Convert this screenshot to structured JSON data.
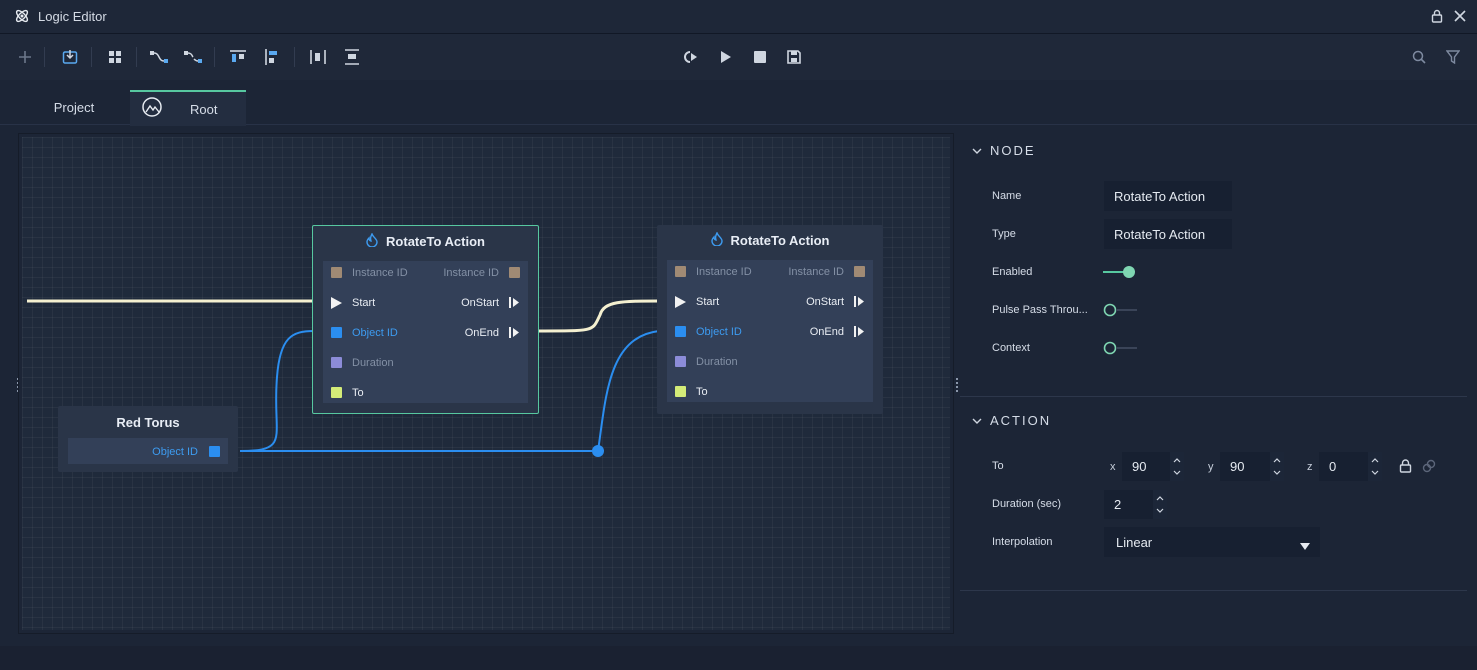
{
  "window": {
    "title": "Logic Editor"
  },
  "toolbar": {
    "left_buttons": [
      "add-icon",
      "import-icon",
      "grid-icon",
      "connect-icon",
      "disconnect-icon",
      "align-top-icon",
      "align-left-icon",
      "distribute-h-icon",
      "distribute-v-icon"
    ],
    "center_buttons": [
      "rewind-icon",
      "play-icon",
      "stop-icon",
      "save-icon"
    ],
    "right_buttons": [
      "search-icon",
      "filter-icon"
    ]
  },
  "tabs": [
    {
      "label": "Project"
    },
    {
      "label": "Root"
    }
  ],
  "graph": {
    "source_node": {
      "title": "Red Torus",
      "port": "Object ID"
    },
    "nodes": [
      {
        "title": "RotateTo Action",
        "selected": true,
        "ports": {
          "instance_in": "Instance ID",
          "instance_out": "Instance ID",
          "start": "Start",
          "on_start": "OnStart",
          "object_id": "Object ID",
          "on_end": "OnEnd",
          "duration": "Duration",
          "to": "To"
        }
      },
      {
        "title": "RotateTo Action",
        "selected": false,
        "ports": {
          "instance_in": "Instance ID",
          "instance_out": "Instance ID",
          "start": "Start",
          "on_start": "OnStart",
          "object_id": "Object ID",
          "on_end": "OnEnd",
          "duration": "Duration",
          "to": "To"
        }
      }
    ],
    "colors": {
      "accent": "#57c8a0",
      "pulse_wire": "#f4f0d0",
      "object_wire": "#2b8ef0",
      "instance_port": "#a08a74",
      "object_port": "#2b8ef0",
      "duration_port": "#8c8cd8",
      "to_port": "#d4ec78"
    }
  },
  "inspector": {
    "node_section": {
      "title": "NODE",
      "name_label": "Name",
      "name_value": "RotateTo Action",
      "type_label": "Type",
      "type_value": "RotateTo Action",
      "enabled_label": "Enabled",
      "enabled": true,
      "pulse_label": "Pulse Pass Throu...",
      "pulse": false,
      "context_label": "Context",
      "context": false
    },
    "action_section": {
      "title": "ACTION",
      "to_label": "To",
      "x_label": "x",
      "x_value": "90",
      "y_label": "y",
      "y_value": "90",
      "z_label": "z",
      "z_value": "0",
      "duration_label": "Duration (sec)",
      "duration_value": "2",
      "interp_label": "Interpolation",
      "interp_value": "Linear"
    }
  }
}
